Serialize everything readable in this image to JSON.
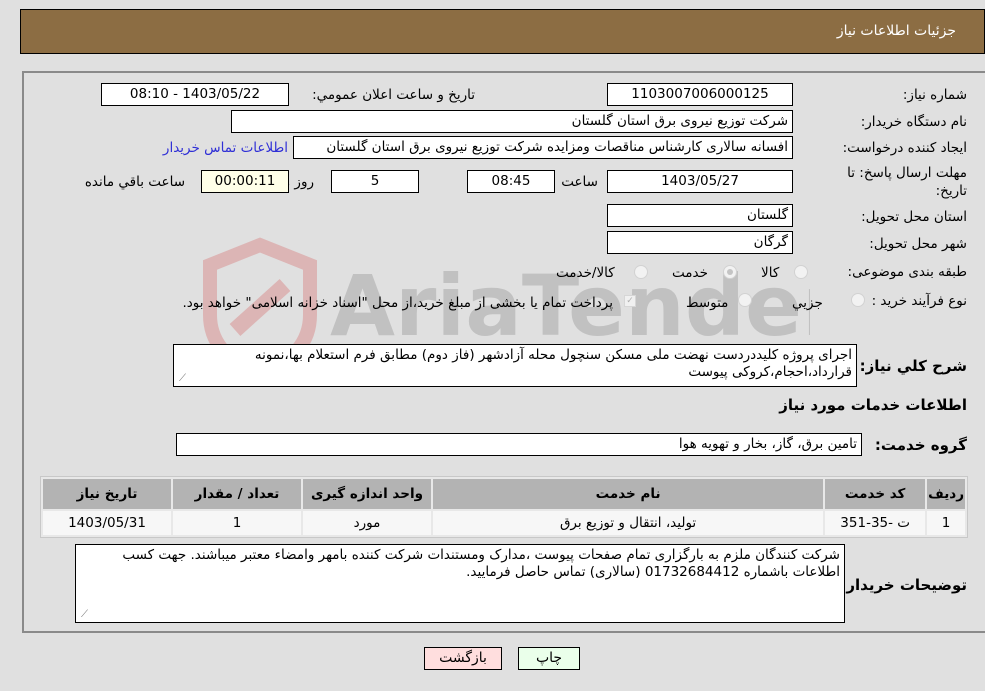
{
  "header": {
    "title": "جزئیات اطلاعات نیاز"
  },
  "form": {
    "need_number": {
      "label": "شماره نیاز:",
      "value": "1103007006000125"
    },
    "announce_datetime": {
      "label": "تاریخ و ساعت اعلان عمومي:",
      "value": "1403/05/22 - 08:10"
    },
    "buyer_org": {
      "label": "نام دستگاه خریدار:",
      "value": "شرکت توزیع نیروی برق استان گلستان"
    },
    "creator": {
      "label": "ایجاد کننده درخواست:",
      "value": "افسانه سالاری کارشناس مناقصات ومزایده شرکت توزیع نیروی برق استان گلستان",
      "contact_link": "اطلاعات تماس خریدار"
    },
    "deadline": {
      "label": "مهلت ارسال پاسخ: تا تاریخ:",
      "date": "1403/05/27",
      "time_label": "ساعت",
      "time": "08:45",
      "days": "5",
      "days_label": "روز و",
      "remaining": "00:00:11",
      "remaining_label": "ساعت باقي مانده"
    },
    "province": {
      "label": "استان محل تحویل:",
      "value": "گلستان"
    },
    "city": {
      "label": "شهر محل تحویل:",
      "value": "گرگان"
    },
    "category": {
      "label": "طبقه بندی موضوعی:",
      "options": [
        "کالا",
        "خدمت",
        "کالا/خدمت"
      ],
      "selected": "خدمت"
    },
    "process_type": {
      "label": "نوع فرآیند خرید :",
      "options": [
        "جزيي",
        "متوسط"
      ],
      "treasury_checkbox_label": "پرداخت تمام یا بخشی از مبلغ خرید،از محل \"اسناد خزانه اسلامی\" خواهد بود.",
      "treasury_checked": true
    },
    "description": {
      "label": "شرح کلي نياز:",
      "value": "اجرای پروژه کلیددردست نهضت ملی مسکن سنچول محله آزادشهر (فاز دوم)  مطابق فرم استعلام بها،نمونه قرارداد،احجام،کروکی پیوست"
    }
  },
  "services": {
    "section_title": "اطلاعات خدمات مورد نیاز",
    "group_label": "گروه خدمت:",
    "group_value": "تامین برق، گاز، بخار و تهویه هوا",
    "columns": [
      "ردیف",
      "کد خدمت",
      "نام خدمت",
      "واحد اندازه گیری",
      "تعداد / مقدار",
      "تاریخ نیاز"
    ],
    "rows": [
      [
        "1",
        "ت -35-351",
        "تولید، انتقال و توزیع برق",
        "مورد",
        "1",
        "1403/05/31"
      ]
    ]
  },
  "buyer_notes": {
    "label": "توضیحات خریدار:",
    "value": "شرکت کنندگان ملزم به بارگزاری تمام صفحات پیوست ،مدارک ومستندات شرکت کننده بامهر وامضاء معتبر میباشند. جهت کسب اطلاعات باشماره 01732684412 (سالاری) تماس حاصل فرمایید."
  },
  "buttons": {
    "print": "چاپ",
    "back": "بازگشت"
  },
  "watermark": {
    "text": "AriaTender.neT"
  },
  "colors": {
    "header_bg": "#8c6d43",
    "link": "#2f2fd6",
    "print_bg": "#eaffea",
    "back_bg": "#ffdede",
    "remaining_bg": "#ffffe8"
  }
}
